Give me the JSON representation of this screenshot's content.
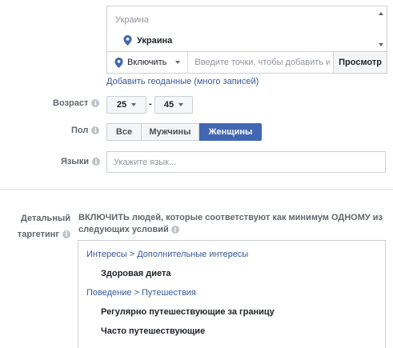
{
  "location": {
    "country_header": "Украина",
    "selected_location": "Украина",
    "include_label": "Включить",
    "input_placeholder": "Введите точки, чтобы добавить их",
    "browse_label": "Просмотр",
    "bulk_link": "Добавить геоданные (много записей)"
  },
  "age": {
    "label": "Возраст",
    "min": "25",
    "separator": "-",
    "max": "45"
  },
  "gender": {
    "label": "Пол",
    "options": [
      "Все",
      "Мужчины",
      "Женщины"
    ],
    "selected": "Женщины"
  },
  "languages": {
    "label": "Языки",
    "placeholder": "Укажите язык..."
  },
  "detailed_targeting": {
    "label_line1": "Детальный",
    "label_line2": "таргетинг",
    "description": "ВКЛЮЧИТЬ людей, которые соответствуют как минимум ОДНОМУ из следующих условий",
    "groups": [
      {
        "path": "Интересы > Дополнительные интересы",
        "items": [
          "Здоровая диета"
        ]
      },
      {
        "path": "Поведение > Путешествия",
        "items": [
          "Регулярно путешествующие за границу",
          "Часто путешествующие"
        ]
      }
    ]
  },
  "colors": {
    "accent": "#4267b2",
    "link": "#365899",
    "border": "#ccd0d5",
    "muted_text": "#606770"
  }
}
